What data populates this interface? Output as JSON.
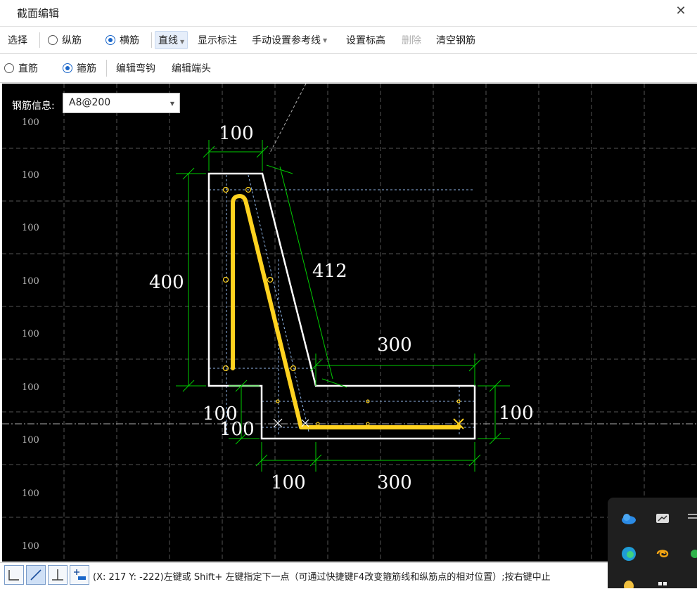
{
  "window": {
    "title": "截面编辑",
    "close_icon": "close-icon"
  },
  "toolbar1": {
    "select": "选择",
    "longitudinal": "纵筋",
    "transverse": "横筋",
    "line": "直线",
    "show_dimension": "显示标注",
    "manual_ref_line": "手动设置参考线",
    "set_elevation": "设置标高",
    "delete": "删除",
    "clear_rebar": "清空钢筋",
    "transverse_checked": true
  },
  "toolbar2": {
    "straight_bar": "直筋",
    "stirrup": "箍筋",
    "edit_hook": "编辑弯钩",
    "edit_end": "编辑端头",
    "stirrup_checked": true
  },
  "rebar_info": {
    "label": "钢筋信息:",
    "value": "A8@200"
  },
  "grid_labels": [
    "100",
    "100",
    "100",
    "100",
    "100",
    "100",
    "100",
    "100",
    "100"
  ],
  "dimensions": {
    "top_width": "100",
    "slope_length": "412",
    "left_height": "400",
    "flange_width": "300",
    "right_height": "100",
    "step_width": "100",
    "step_height": "100",
    "bottom_left": "100",
    "bottom_right": "300"
  },
  "status": {
    "text": "(X: 217 Y: -222)左键或 Shift+ 左键指定下一点（可通过快捷键F4改变箍筋线和纵筋点的相对位置）;按右键中止"
  },
  "colors": {
    "canvas_bg": "#000000",
    "outline": "#ffffff",
    "rebar": "#ffd21f",
    "dimension": "#00cc00",
    "accent": "#1a66c9"
  }
}
